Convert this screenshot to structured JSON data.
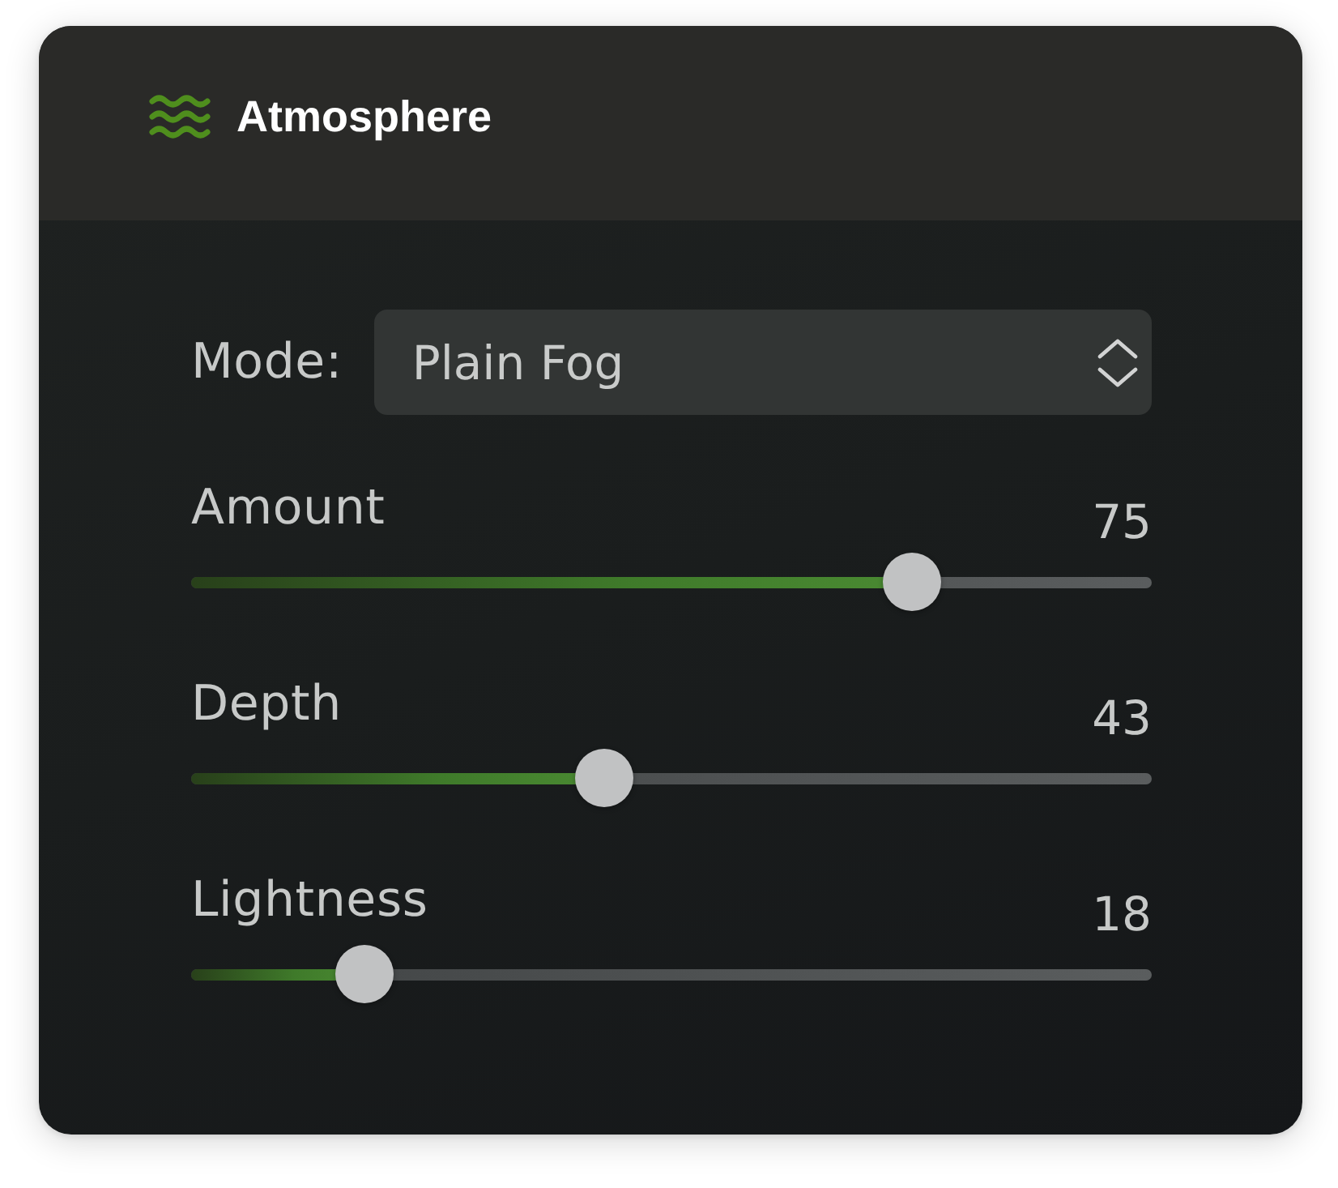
{
  "panel": {
    "title": "Atmosphere"
  },
  "mode": {
    "label": "Mode:",
    "value": "Plain Fog"
  },
  "sliders": [
    {
      "label": "Amount",
      "value": "75",
      "level": 0.75
    },
    {
      "label": "Depth",
      "value": "43",
      "level": 0.43
    },
    {
      "label": "Lightness",
      "value": "18",
      "level": 0.18
    }
  ]
}
